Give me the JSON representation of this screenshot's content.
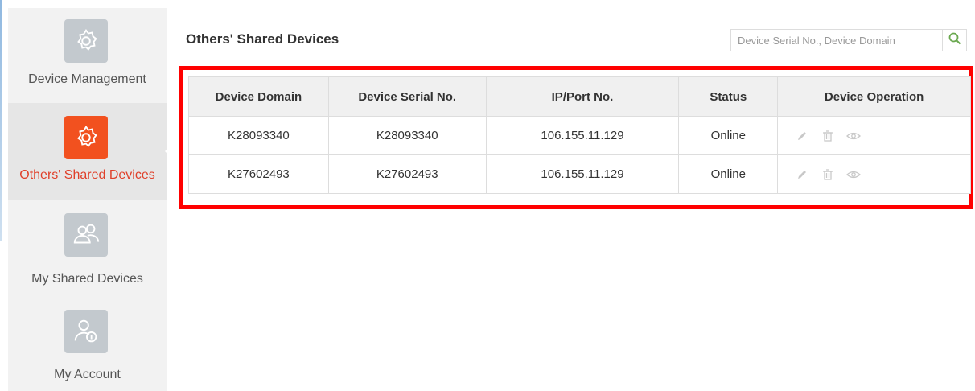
{
  "sidebar": {
    "items": [
      {
        "label": "Device Management",
        "icon": "gear-icon",
        "active": false
      },
      {
        "label": "Others' Shared Devices",
        "icon": "gear-icon",
        "active": true
      },
      {
        "label": "My Shared Devices",
        "icon": "users-icon",
        "active": false
      },
      {
        "label": "My Account",
        "icon": "user-info-icon",
        "active": false
      }
    ]
  },
  "main": {
    "title": "Others' Shared Devices",
    "search": {
      "placeholder": "Device Serial No., Device Domain",
      "value": ""
    },
    "table": {
      "columns": [
        "Device Domain",
        "Device Serial No.",
        "IP/Port No.",
        "Status",
        "Device Operation"
      ],
      "rows": [
        {
          "domain": "K28093340",
          "serial": "K28093340",
          "ip": "106.155.11.129",
          "status": "Online",
          "operations": [
            "edit-icon",
            "delete-icon",
            "view-icon"
          ]
        },
        {
          "domain": "K27602493",
          "serial": "K27602493",
          "ip": "106.155.11.129",
          "status": "Online",
          "operations": [
            "edit-icon",
            "delete-icon",
            "view-icon"
          ]
        }
      ]
    }
  },
  "colors": {
    "accent": "#f2511f",
    "link": "#1e6fb8",
    "status_online": "#55a532",
    "highlight": "#ff0000",
    "icon_inactive": "#c3c9ce"
  }
}
